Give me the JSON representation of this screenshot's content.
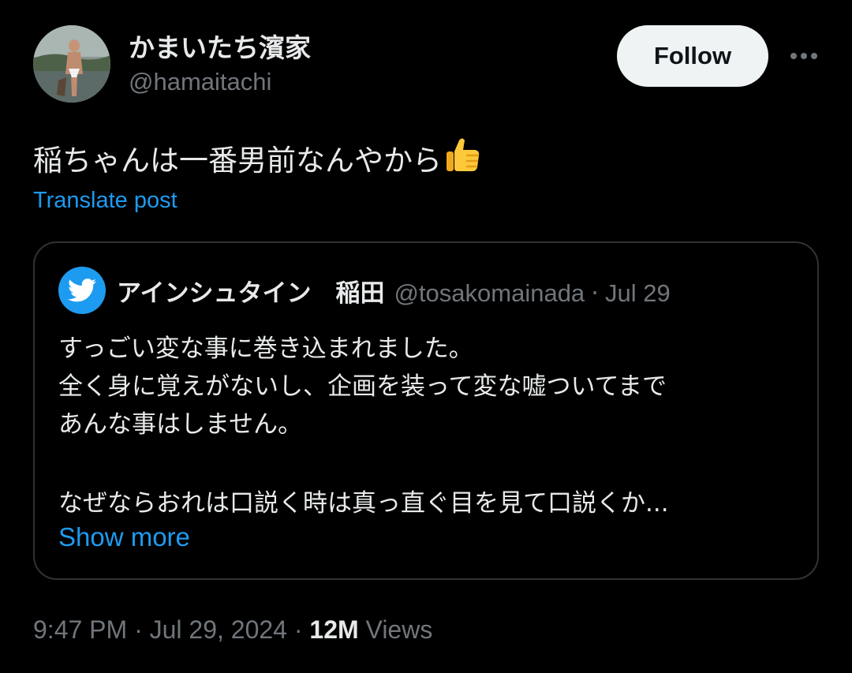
{
  "author": {
    "display_name": "かまいたち濱家",
    "handle": "@hamaitachi"
  },
  "actions": {
    "follow_label": "Follow",
    "more_icon": "more-horizontal-icon"
  },
  "post": {
    "text": "稲ちゃんは一番男前なんやから",
    "emoji": "thumbs-up",
    "translate_label": "Translate post"
  },
  "quoted": {
    "avatar_icon": "twitter-bird-icon",
    "display_name": "アインシュタイン　稲田",
    "handle": "@tosakomainada",
    "separator": "·",
    "date": "Jul 29",
    "lines": [
      "すっごい変な事に巻き込まれました。",
      "全く身に覚えがないし、企画を装って変な嘘ついてまで",
      "あんな事はしません。",
      "なぜならおれは口説く時は真っ直ぐ目を見て口説くか..."
    ],
    "show_more_label": "Show more"
  },
  "meta": {
    "timestamp": "9:47 PM · Jul 29, 2024 · ",
    "views_count": "12M",
    "views_label": " Views"
  },
  "colors": {
    "background": "#000000",
    "text_primary": "#e7e9ea",
    "text_secondary": "#71767b",
    "accent": "#1d9bf0",
    "border": "#2f3336"
  }
}
